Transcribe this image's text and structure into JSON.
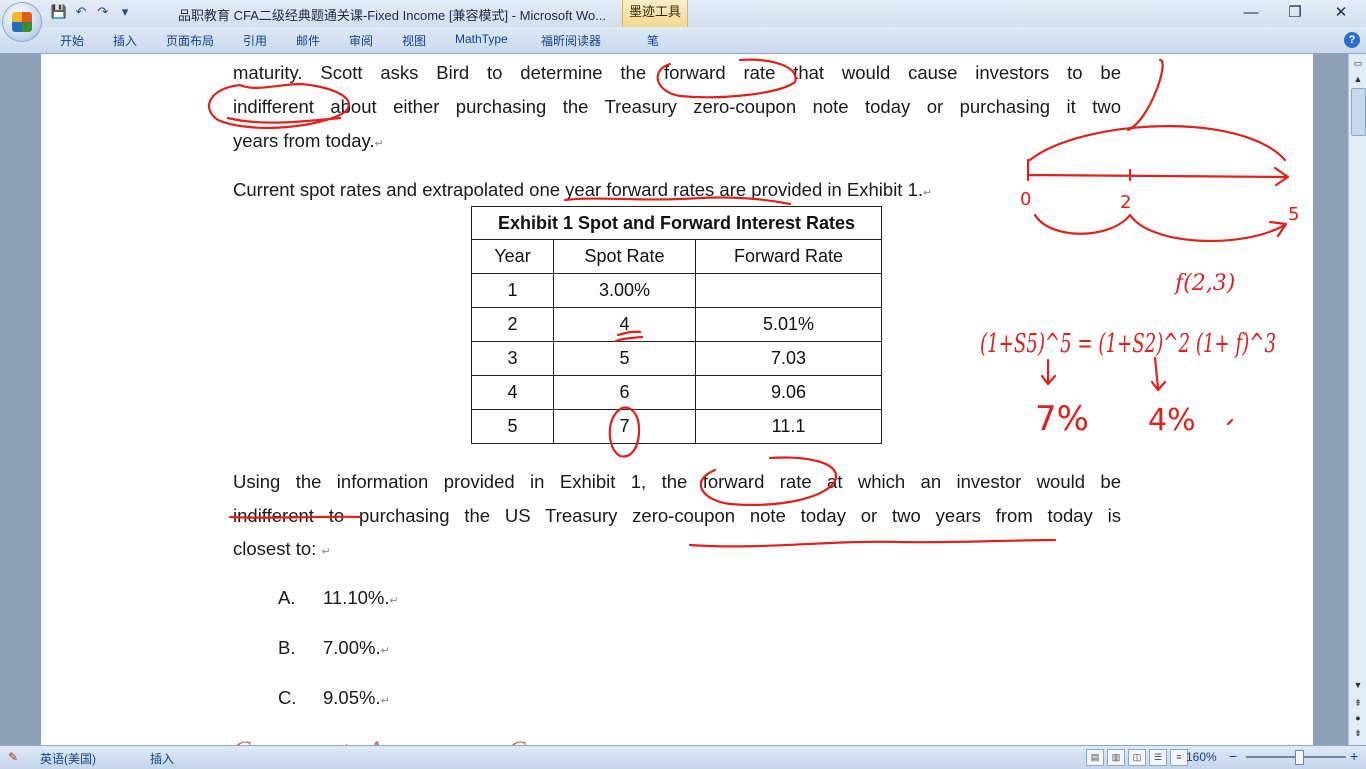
{
  "window": {
    "title": "品职教育 CFA二级经典题通关课-Fixed Income [兼容模式] - Microsoft Wo...",
    "context_tab": "墨迹工具",
    "controls": {
      "minimize": "—",
      "restore": "❐",
      "close": "✕"
    }
  },
  "quick_access": {
    "save": "💾",
    "undo": "↶",
    "redo": "↷",
    "more": "▾"
  },
  "ribbon_tabs": [
    "开始",
    "插入",
    "页面布局",
    "引用",
    "邮件",
    "审阅",
    "视图",
    "MathType",
    "福昕阅读器",
    "笔"
  ],
  "document": {
    "para1": [
      "maturity. Scott asks Bird to determine the forward rate that would cause investors to be",
      "indifferent about either purchasing the Treasury zero-coupon note today or purchasing it two",
      "years from today."
    ],
    "para2": "Current spot rates and extrapolated one year forward rates are provided in Exhibit 1.",
    "table": {
      "caption": "Exhibit 1 Spot and Forward Interest Rates",
      "headers": [
        "Year",
        "Spot Rate",
        "Forward Rate"
      ],
      "rows": [
        [
          "1",
          "3.00%",
          ""
        ],
        [
          "2",
          "4",
          "5.01%"
        ],
        [
          "3",
          "5",
          "7.03"
        ],
        [
          "4",
          "6",
          "9.06"
        ],
        [
          "5",
          "7",
          "11.1"
        ]
      ]
    },
    "question": [
      "Using the information provided in Exhibit 1, the forward rate at which an investor would be",
      "indifferent to purchasing the US Treasury zero-coupon note today or two years from today is",
      "closest to:"
    ],
    "answers": [
      {
        "letter": "A.",
        "text": "11.10%."
      },
      {
        "letter": "B.",
        "text": "7.00%."
      },
      {
        "letter": "C.",
        "text": "9.05%."
      }
    ],
    "cut_off_text": "Correct Answer: C"
  },
  "annotations": {
    "handwriting": [
      "0",
      "2",
      "5",
      "f(2,3)",
      "(1+S5)^5 = (1+S2)^2 (1+ f)^3",
      "7%",
      "4%"
    ],
    "ink_color": "#e0201a"
  },
  "statusbar": {
    "language": "英语(美国)",
    "mode": "插入",
    "zoom": "160%",
    "zoom_minus": "−",
    "zoom_plus": "+"
  }
}
